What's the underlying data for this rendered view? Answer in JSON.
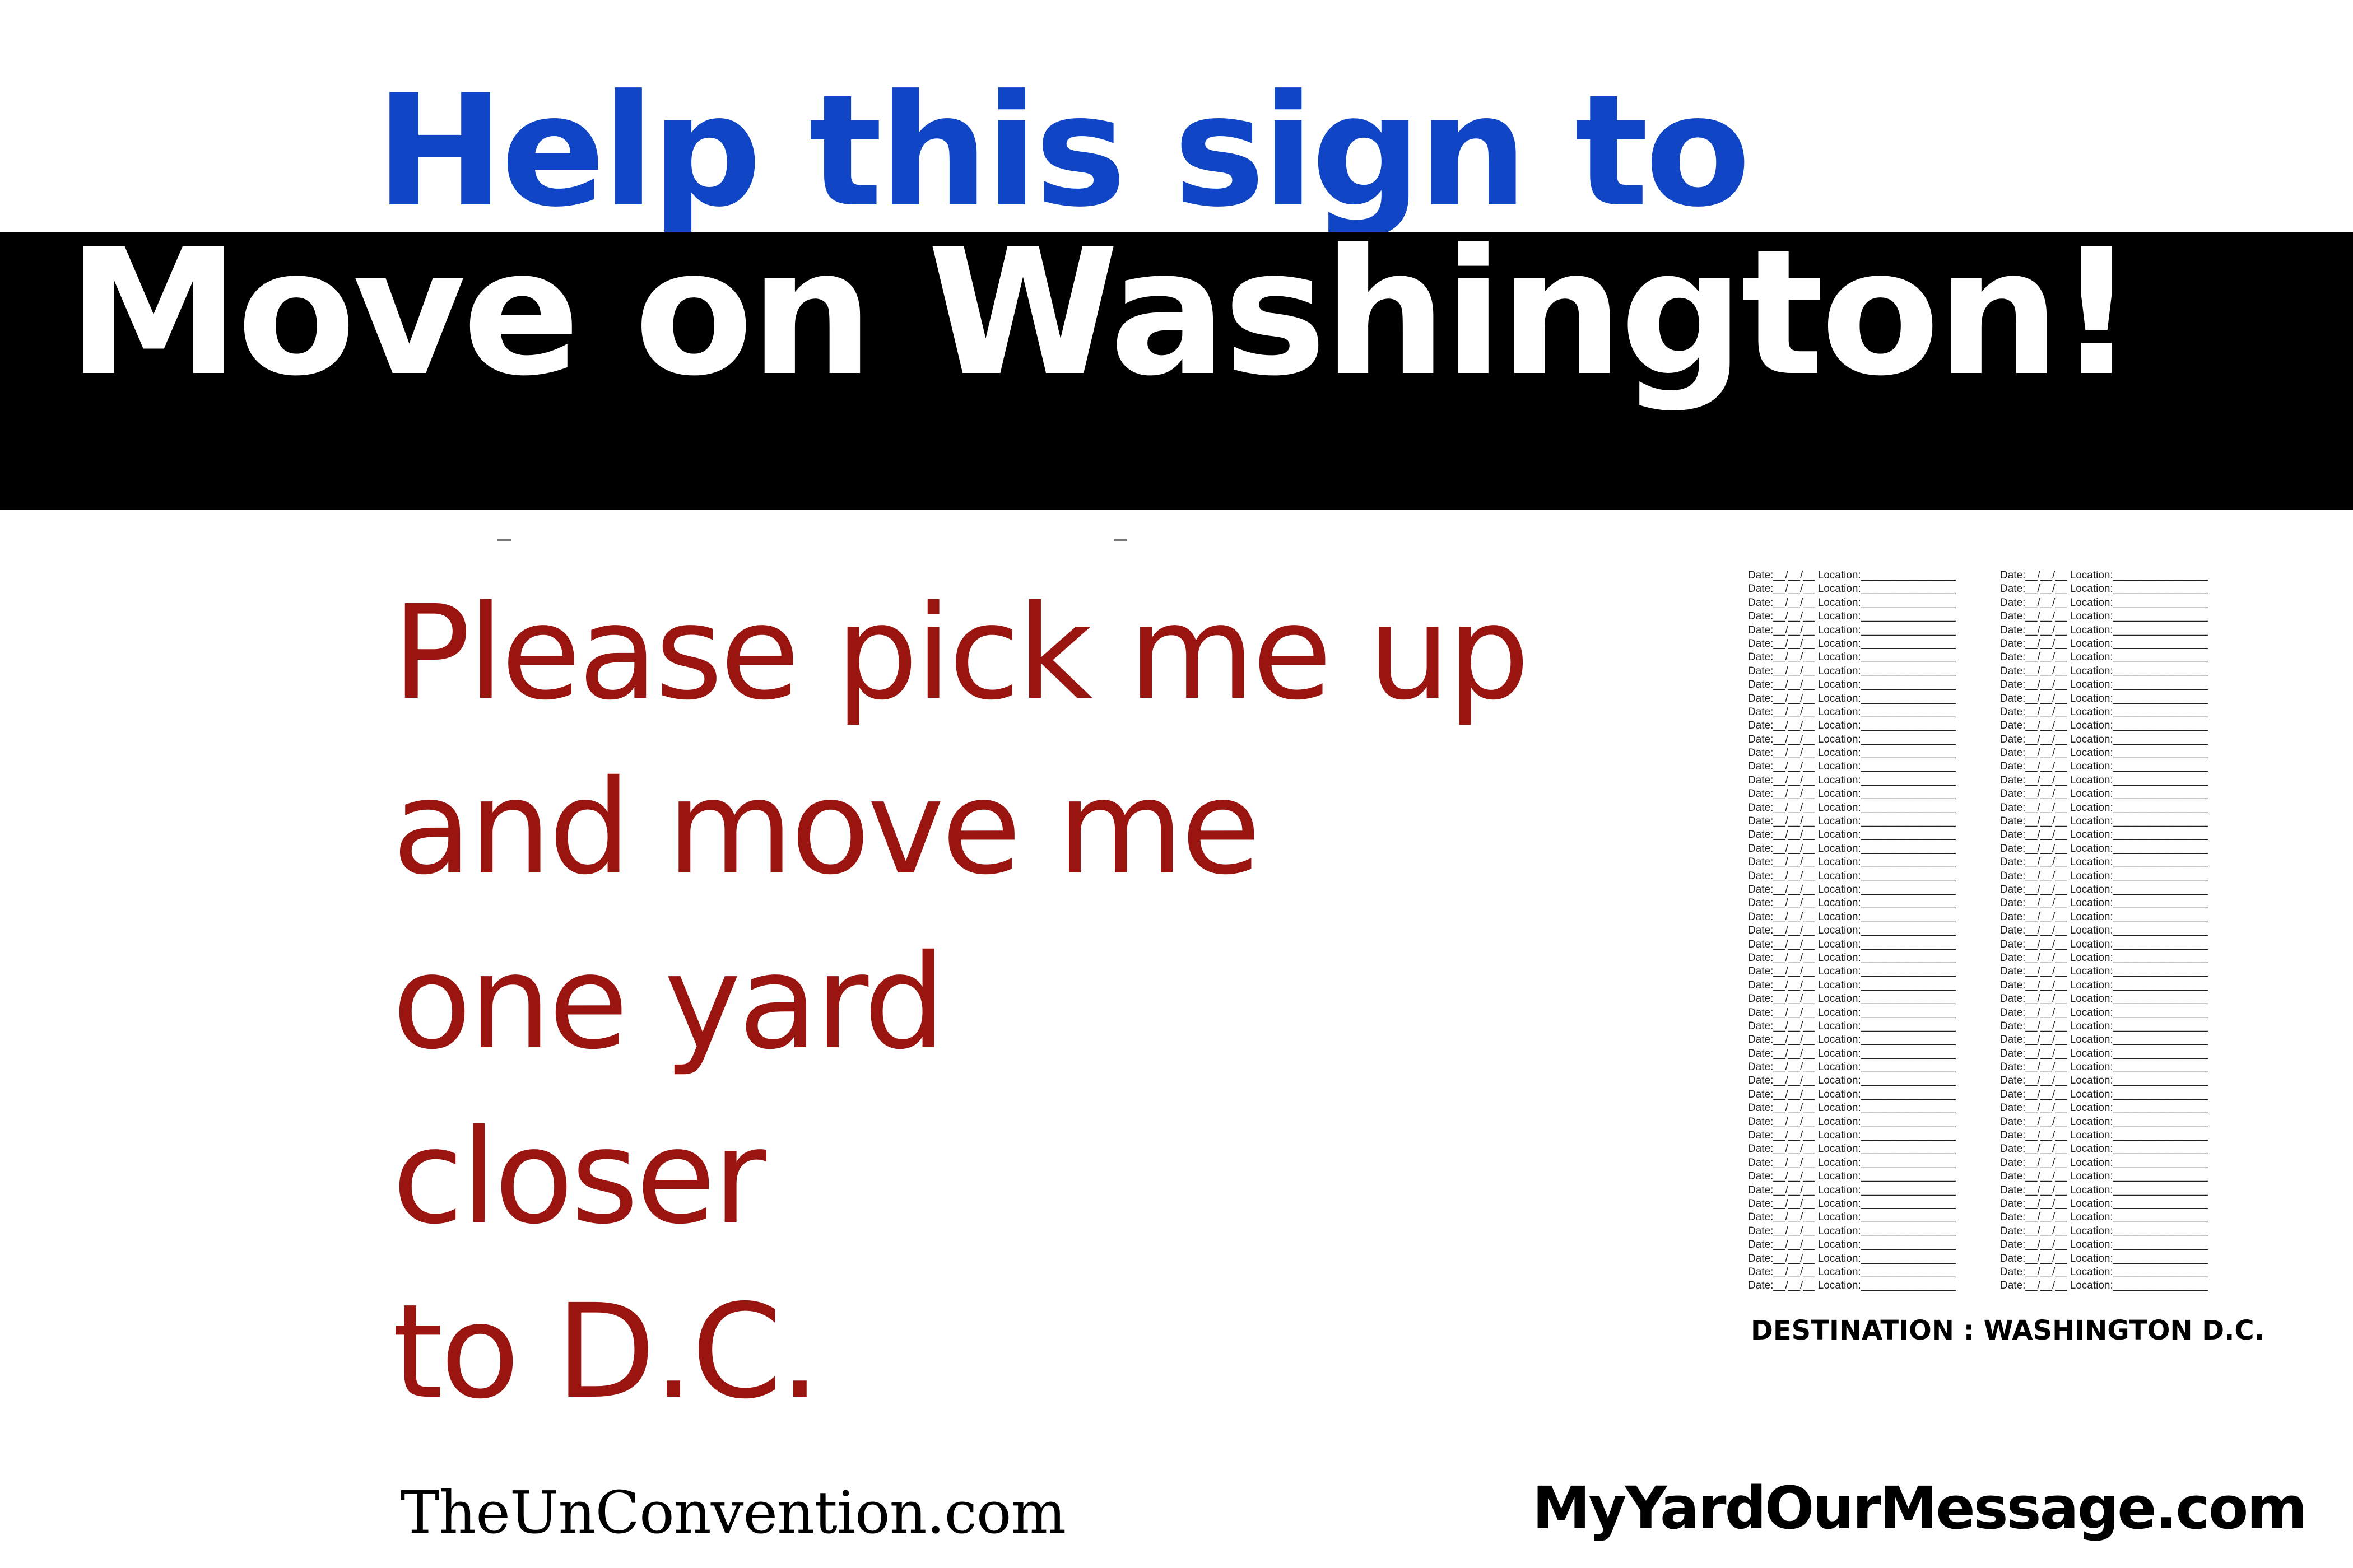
{
  "headline": {
    "top_line": "Help this sign to",
    "main_line": "Move on Washington!"
  },
  "message": {
    "lines": [
      "Please pick me up",
      "and move me",
      "one yard",
      "closer",
      "to D.C."
    ]
  },
  "log": {
    "entry_text": "Date:__/__/__  Location:________________",
    "rows_per_column": 53,
    "columns": 2
  },
  "destination": "DESTINATION : WASHINGTON D.C.",
  "footer": {
    "left_site": "TheUnConvention.com",
    "right_site": "MyYardOurMessage.com"
  },
  "colors": {
    "headline_blue": "#1046c6",
    "band_black": "#000000",
    "message_red": "#9a1410"
  }
}
